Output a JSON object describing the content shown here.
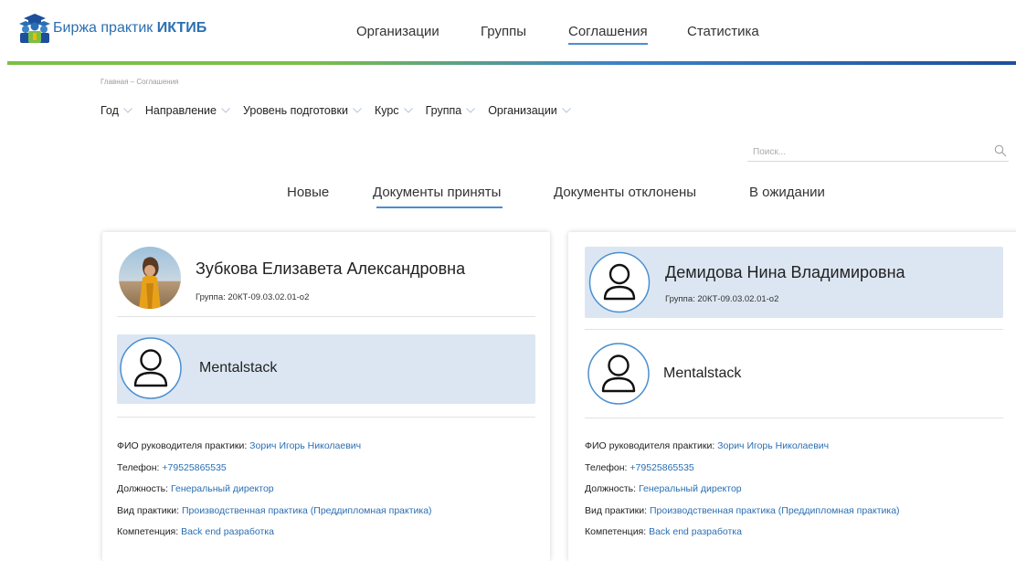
{
  "header": {
    "logo_prefix": "Биржа практик",
    "logo_bold": "ИКТИБ",
    "nav": [
      {
        "label": "Организации",
        "active": false
      },
      {
        "label": "Группы",
        "active": false
      },
      {
        "label": "Соглашения",
        "active": true
      },
      {
        "label": "Статистика",
        "active": false
      }
    ]
  },
  "breadcrumb": "Главная – Соглашения",
  "filters": [
    "Год",
    "Направление",
    "Уровень подготовки",
    "Курс",
    "Группа",
    "Организации"
  ],
  "search": {
    "placeholder": "Поиск...",
    "value": ""
  },
  "tabs": [
    {
      "label": "Новые",
      "active": false
    },
    {
      "label": "Документы приняты",
      "active": true
    },
    {
      "label": "Документы отклонены",
      "active": false
    },
    {
      "label": "В ожидании",
      "active": false
    }
  ],
  "cards": [
    {
      "name": "Зубкова Елизавета Александровна",
      "group": "Группа: 20КТ-09.03.02.01-о2",
      "avatar": "photo",
      "org_name": "Mentalstack",
      "details": [
        {
          "label": "ФИО руководителя практики:",
          "value": "Зорич Игорь Николаевич"
        },
        {
          "label": "Телефон:",
          "value": "+79525865535"
        },
        {
          "label": "Должность:",
          "value": "Генеральный директор"
        },
        {
          "label": "Вид практики:",
          "value": "Производственная практика (Преддипломная практика)"
        },
        {
          "label": "Компетенция:",
          "value": "Back end разработка"
        }
      ]
    },
    {
      "name": "Демидова Нина Владимировна",
      "group": "Группа: 20КТ-09.03.02.01-о2",
      "avatar": "user-placeholder-icon",
      "org_name": "Mentalstack",
      "details": [
        {
          "label": "ФИО руководителя практики:",
          "value": "Зорич Игорь Николаевич"
        },
        {
          "label": "Телефон:",
          "value": "+79525865535"
        },
        {
          "label": "Должность:",
          "value": "Генеральный директор"
        },
        {
          "label": "Вид практики:",
          "value": "Производственная практика (Преддипломная практика)"
        },
        {
          "label": "Компетенция:",
          "value": "Back end разработка"
        }
      ]
    }
  ],
  "colors": {
    "link": "#2a6fb3",
    "highlight": "#dce6f2",
    "accent_green": "#7cbf45",
    "accent_blue": "#1d4f9c"
  }
}
